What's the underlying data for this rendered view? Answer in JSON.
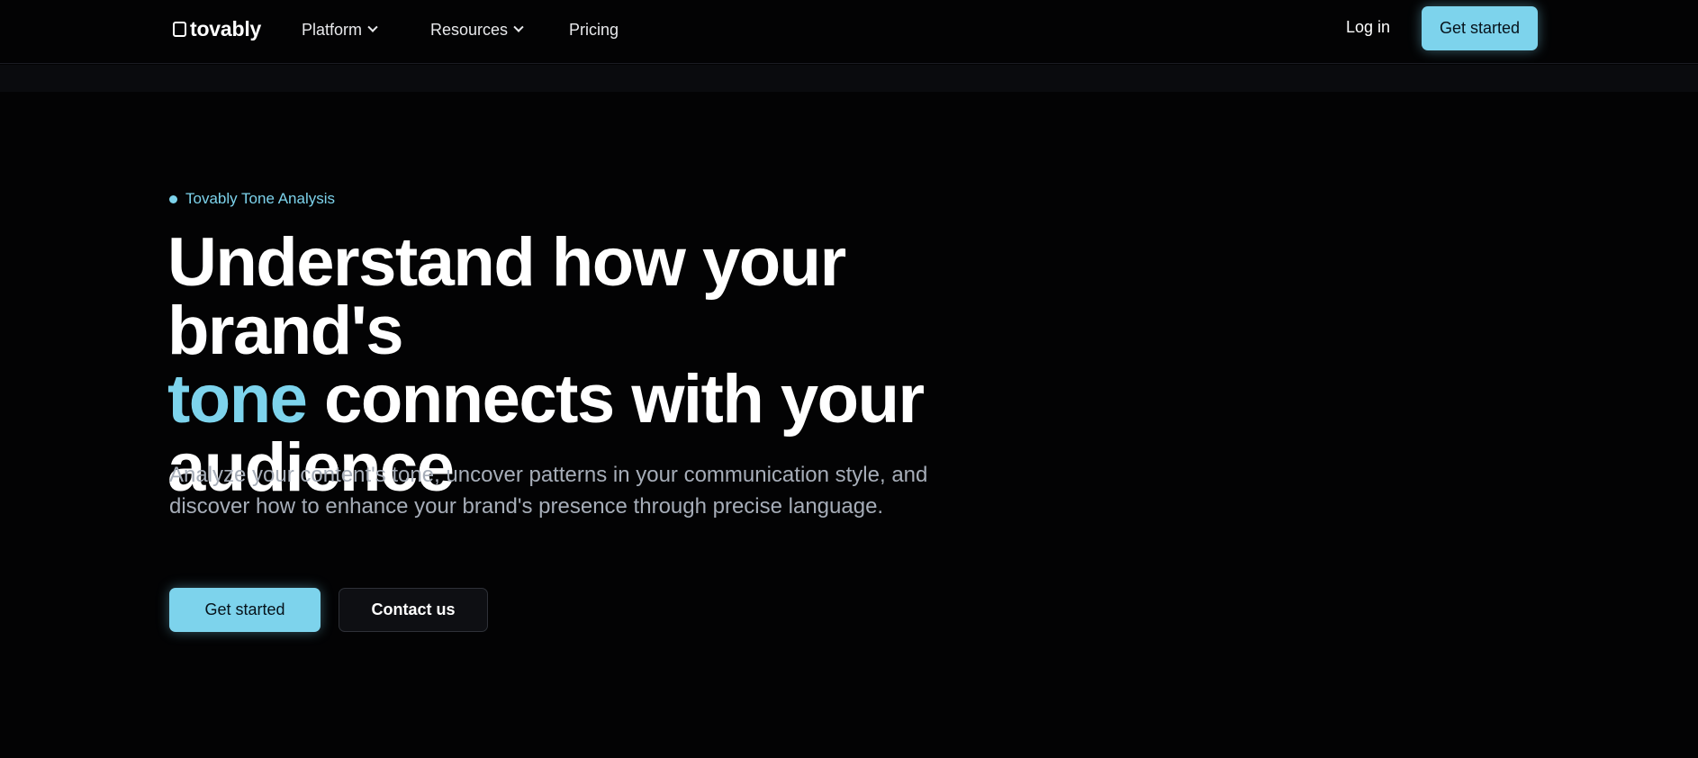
{
  "nav": {
    "logo_text": "tovably",
    "items": [
      {
        "label": "Platform",
        "has_dropdown": true
      },
      {
        "label": "Resources",
        "has_dropdown": true
      },
      {
        "label": "Pricing",
        "has_dropdown": false
      }
    ],
    "login_label": "Log in",
    "cta_label": "Get started"
  },
  "hero": {
    "eyebrow": "Tovably Tone Analysis",
    "headline_part1": "Understand how your brand's",
    "headline_accent": "tone",
    "headline_part2": " connects with your audience",
    "subtext": "Analyze your content's tone, uncover patterns in your communication style, and discover how to enhance your brand's presence through precise language.",
    "primary_button": "Get started",
    "secondary_button": "Contact us"
  },
  "colors": {
    "background": "#030304",
    "accent": "#7dd3ec",
    "body_text": "#a6adb8"
  },
  "icons": [
    "logo-square-icon",
    "chevron-down-icon"
  ]
}
